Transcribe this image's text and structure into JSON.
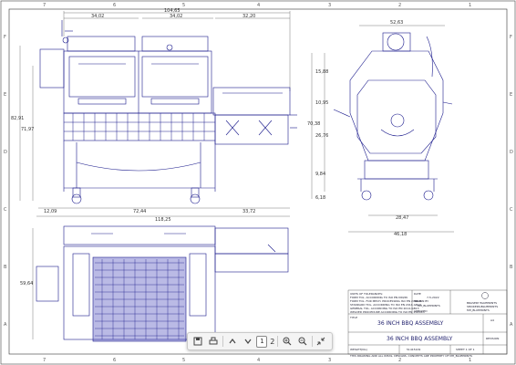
{
  "grid": {
    "top_columns": [
      "7",
      "6",
      "5",
      "4",
      "3",
      "2",
      "1"
    ],
    "bottom_columns": [
      "7",
      "6",
      "5",
      "4",
      "3",
      "2",
      "1"
    ],
    "rows": [
      "F",
      "E",
      "D",
      "C",
      "B",
      "A"
    ]
  },
  "front_view": {
    "overall_width": "104,65",
    "section_left": "34,02",
    "section_mid": "34,02",
    "section_right": "32,20",
    "height_total": "82,91",
    "height_body": "71,97",
    "width_left": "12,09",
    "width_mid": "72,44",
    "width_right": "33,72",
    "overall_base": "118,25"
  },
  "side_view": {
    "top_width": "52,63",
    "h1": "15,88",
    "h2": "10,95",
    "h3": "70,38",
    "h4": "26,76",
    "h5": "9,84",
    "h6": "6,18",
    "base_width1": "28,47",
    "base_width2": "46,18"
  },
  "top_view": {
    "depth": "59,64"
  },
  "title_block": {
    "notes": [
      "UNITS OF TOLERANCES:",
      "FORM TOL. ACCORDING TO ISO EN DIN/IN",
      "FORM TOL. FOR MECH. PROCESSING ISO EN 2768-M",
      "STANDARD TOL. ACCORDING TO ISO EN 2014-GB13",
      "GENERAL TOL. ACCORDING TO ISO EN 2014-GB13",
      "WELDED PROCEDURE ACCORDING TO ISO EN 15614-1"
    ],
    "date_label": "DATE",
    "date_value": "7-5-2022",
    "drawn_label": "DRAWN BY",
    "drawn_value": "MH_BLUEPRINTS",
    "checked_label": "CHECKED",
    "title_label": "TITLE",
    "title": "36 INCH BBQ ASSEMBLY",
    "sub_title": "36 INCH BBQ ASSEMBLY",
    "company_line1": "BRASERY BLUEPRINTS",
    "company_line2": "SMOKERS/BLUEPRINTS",
    "company_line3": "MH_BLUEPRINTS",
    "weight_label": "WEIGHT(KG)",
    "part_no": "51415109",
    "sheet": "SHEET 1 OF 1",
    "revision": "REVISION",
    "size": "A4",
    "copyright": "THIS DRAWING AND ALL IDEAS, DESIGNS, CONCEPTS ARE PROPERTY OF MH_BLUEPRINTS"
  },
  "viewer": {
    "page_current": "1",
    "page_total": "2",
    "icons": [
      "save-icon",
      "print-icon",
      "chevron-up-icon",
      "chevron-down-icon",
      "zoom-in-icon",
      "zoom-out-icon",
      "collapse-icon"
    ]
  },
  "colors": {
    "drawing_line": "#1a1a8c",
    "dim_line": "#555555",
    "frame": "#333333"
  }
}
